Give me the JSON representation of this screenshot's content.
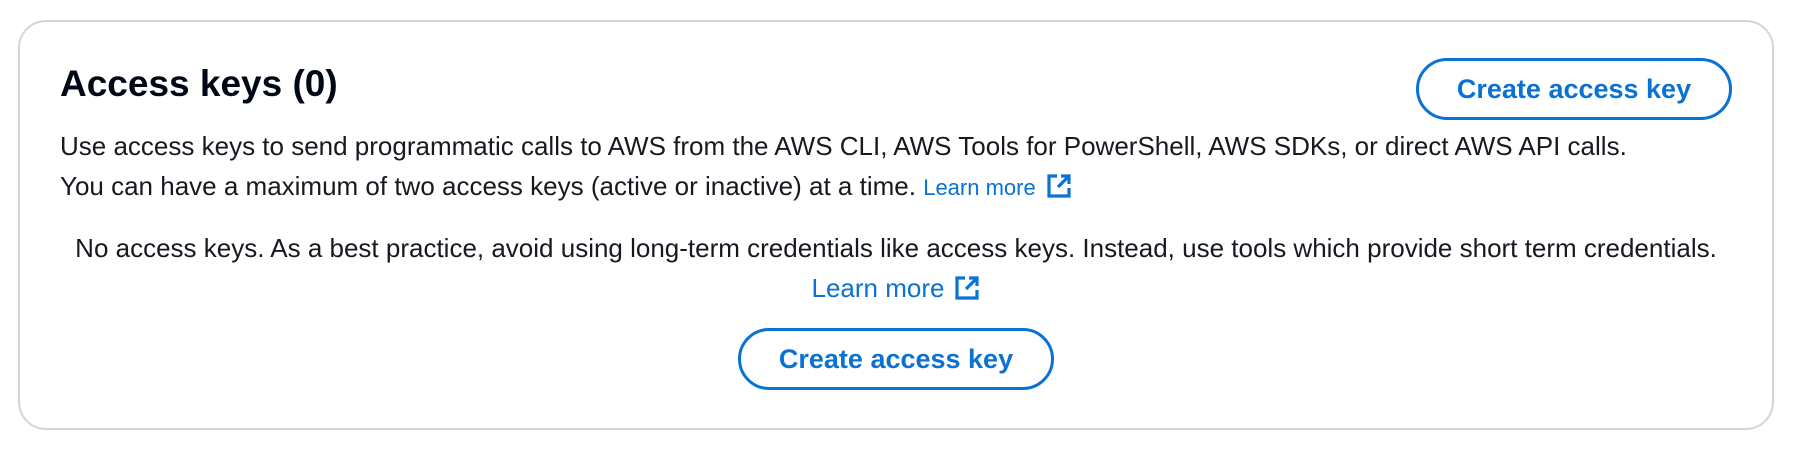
{
  "panel": {
    "title": "Access keys (0)",
    "header_button_label": "Create access key",
    "description_line1": "Use access keys to send programmatic calls to AWS from the AWS CLI, AWS Tools for PowerShell, AWS SDKs, or direct AWS API calls.",
    "description_line2": "You can have a maximum of two access keys (active or inactive) at a time.",
    "description_link": "Learn more",
    "empty_state_text": "No access keys. As a best practice, avoid using long-term credentials like access keys. Instead, use tools which provide short term credentials.",
    "empty_state_link": "Learn more",
    "empty_state_button_label": "Create access key"
  },
  "icons": {
    "external_link": "external-link-icon"
  },
  "colors": {
    "accent": "#0972d3",
    "text": "#16191f",
    "border": "#d1d5db"
  }
}
